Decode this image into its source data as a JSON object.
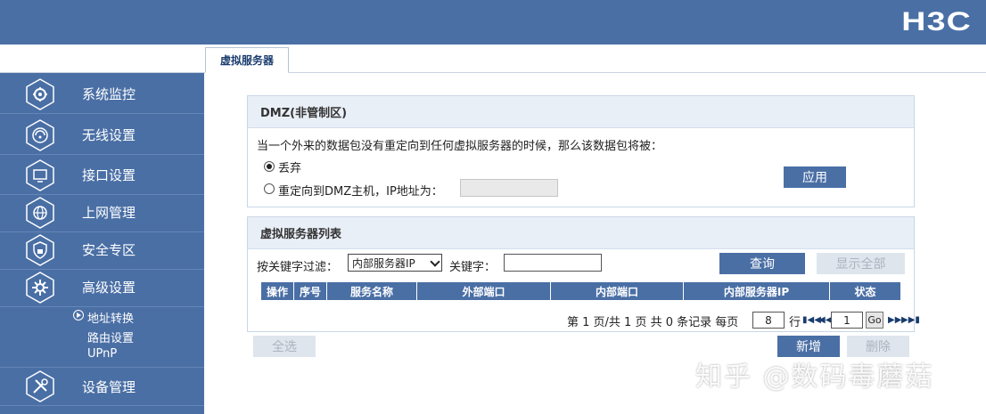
{
  "brand": {
    "logo": "H3C",
    "color": "#4a6fa5"
  },
  "tab": {
    "label": "虚拟服务器"
  },
  "sidebar": {
    "items": [
      {
        "label": "系统监控",
        "icon": "gear-gauge-icon"
      },
      {
        "label": "无线设置",
        "icon": "wifi-icon"
      },
      {
        "label": "接口设置",
        "icon": "monitor-icon"
      },
      {
        "label": "上网管理",
        "icon": "globe-icon"
      },
      {
        "label": "安全专区",
        "icon": "shield-lock-icon"
      },
      {
        "label": "高级设置",
        "icon": "gear-icon"
      },
      {
        "label": "设备管理",
        "icon": "tools-icon"
      }
    ],
    "sub_items": [
      "地址转换",
      "路由设置",
      "UPnP"
    ]
  },
  "dmz": {
    "title": "DMZ(非管制区)",
    "description": "当一个外来的数据包没有重定向到任何虚拟服务器的时候，那么该数据包将被：",
    "option_drop": "丢弃",
    "option_redirect": "重定向到DMZ主机，IP地址为：",
    "ip_value": "",
    "apply_label": "应用",
    "selected": "丢弃"
  },
  "list": {
    "title": "虚拟服务器列表",
    "filter_label": "按关键字过滤：",
    "filter_selected": "内部服务器IP",
    "keyword_label": "关键字：",
    "keyword_value": "",
    "query_label": "查询",
    "show_all_label": "显示全部",
    "columns": [
      "操作",
      "序号",
      "服务名称",
      "外部端口",
      "内部端口",
      "内部服务器IP",
      "状态"
    ],
    "rows": [],
    "pager": {
      "summary": "第 1 页/共 1 页 共 0 条记录 每页",
      "per_page": "8",
      "row_unit": "行",
      "page_input": "1",
      "go_label": "Go"
    }
  },
  "actions": {
    "select_all_label": "全选",
    "add_label": "新增",
    "delete_label": "删除"
  },
  "watermark": "知乎 @数码毒蘑菇"
}
